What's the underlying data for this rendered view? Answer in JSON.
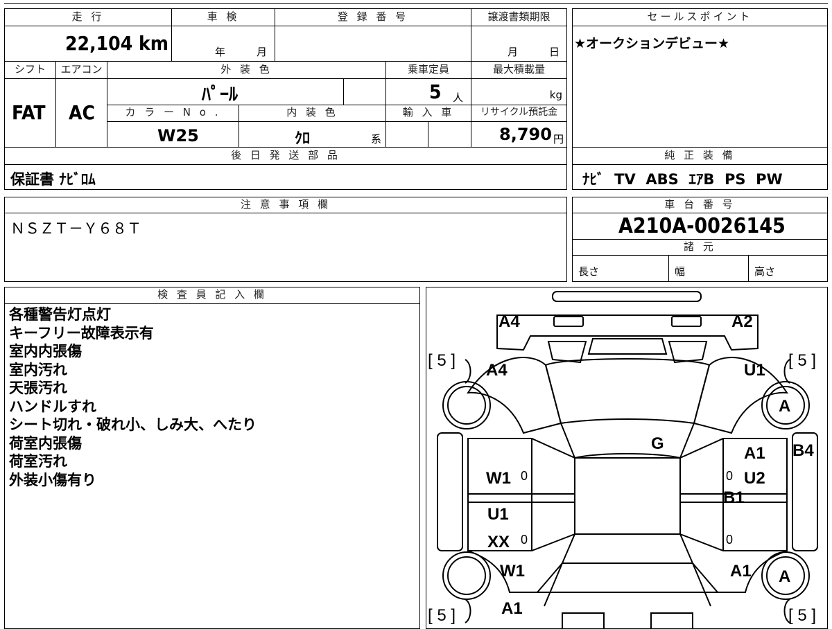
{
  "top_strip": {
    "partial_text": ""
  },
  "basic": {
    "mileage_label": "走 行",
    "mileage_value": "22,104 km",
    "inspection_label": "車 検",
    "inspection_year": "年",
    "inspection_month": "月",
    "registration_label": "登 録 番 号",
    "registration_value": "",
    "transfer_label": "譲渡書類期限",
    "transfer_month": "月",
    "transfer_day": "日"
  },
  "spec": {
    "shift_label": "シフト",
    "shift_value": "FAT",
    "ac_label": "エアコン",
    "ac_value": "AC",
    "exterior_label": "外 装 色",
    "exterior_value": "ﾊﾟｰﾙ",
    "capacity_label": "乗車定員",
    "capacity_value": "5",
    "capacity_unit": "人",
    "maxload_label": "最大積載量",
    "maxload_unit": "kg",
    "colorno_label": "カ ラ ー N o .",
    "colorno_value": "W25",
    "interior_label": "内 装 色",
    "interior_value": "ｸﾛ",
    "interior_suffix": "系",
    "import_label": "輸 入 車",
    "recycle_label": "リサイクル預託金",
    "recycle_value": "8,790",
    "recycle_unit": "円"
  },
  "sales_point": {
    "label": "セールスポイント",
    "value": "★オークションデビュー★"
  },
  "later_parts": {
    "label": "後 日 発 送 部 品",
    "value": "保証書 ﾅﾋﾞﾛﾑ"
  },
  "genuine_equipment": {
    "label": "純 正 装 備",
    "value": "ﾅﾋﾞ  TV  ABS  ｴｱB  PS  PW"
  },
  "caution": {
    "label": "注 意 事 項 欄",
    "value": "ＮＳＺＴ－Ｙ６８Ｔ"
  },
  "chassis": {
    "label": "車 台 番 号",
    "value": "A210A-0026145"
  },
  "dimensions": {
    "label": "諸 元",
    "length": "長さ",
    "width": "幅",
    "height": "高さ"
  },
  "inspector": {
    "label": "検 査 員 記 入 欄",
    "notes": [
      "各種警告灯点灯",
      "キーフリー故障表示有",
      "室内内張傷",
      "室内汚れ",
      "天張汚れ",
      "ハンドルすれ",
      "シート切れ・破れ小、しみ大、へたり",
      "荷室内張傷",
      "荷室汚れ",
      "外装小傷有り"
    ]
  },
  "diagram": {
    "labels": {
      "front_left": "A4",
      "front_right": "A2",
      "bracket_tl": "[ 5 ]",
      "bracket_tr": "[ 5 ]",
      "bracket_bl": "[ 5 ]",
      "bracket_br": "[ 5 ]",
      "fender_left": "A4",
      "fender_right": "U1",
      "tire_fr": "A",
      "tire_rr": "A",
      "roof": "G",
      "door_right_top_1": "A1",
      "door_right_top_2": "U2",
      "sill_right": "B1",
      "side_right": "B4",
      "door_left_front": "W1",
      "door_left_rear_1": "U1",
      "door_left_rear_2": "XX",
      "rear_left": "W1",
      "rear_right": "A1",
      "bumper_rear": "A1",
      "zero_1": "0",
      "zero_2": "0",
      "zero_3": "0",
      "zero_4": "0"
    }
  }
}
